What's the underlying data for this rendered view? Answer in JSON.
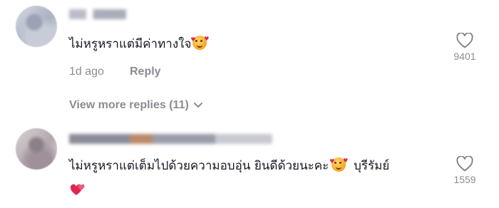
{
  "comments": [
    {
      "text": "ไม่หรูหราแต่มีค่าทางใจ",
      "emoji": "smiling-face-with-hearts",
      "time": "1d ago",
      "reply_label": "Reply",
      "likes": "9401",
      "icon": "heart-outline-icon"
    },
    {
      "text": "ไม่หรูหราแต่เต็มไปด้วยความอบอุ่น ยินดีด้วยนะคะ",
      "emoji": "smiling-face-with-hearts",
      "text_after": "บุรีรัมย์",
      "emoji_line2": "two-hearts",
      "likes": "1559",
      "icon": "heart-outline-icon"
    }
  ],
  "view_more": {
    "label": "View more replies (11)",
    "icon": "chevron-down-icon"
  },
  "colors": {
    "text": "#161823",
    "muted": "rgba(22,24,35,0.5)",
    "heart_red": "#e2264d"
  }
}
